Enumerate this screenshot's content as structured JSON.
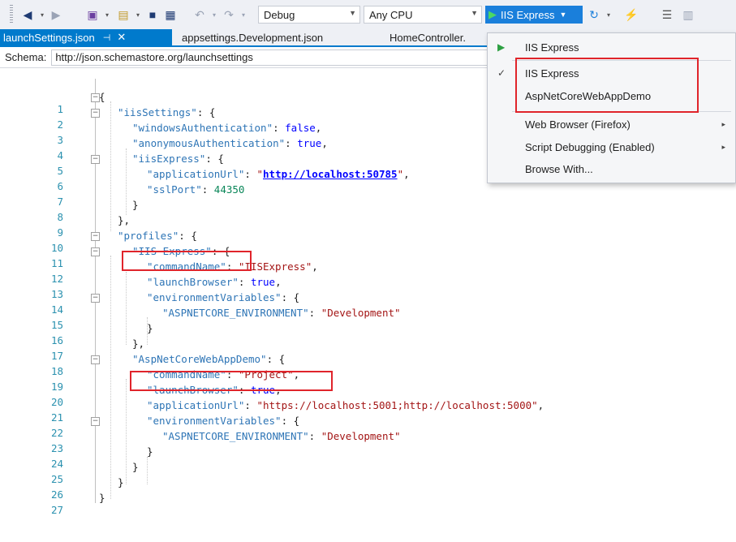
{
  "toolbar": {
    "config_label": "Debug",
    "platform_label": "Any CPU",
    "run_label": "IIS Express"
  },
  "tabs": [
    {
      "label": "launchSettings.json"
    },
    {
      "label": "appsettings.Development.json"
    },
    {
      "label": "HomeController."
    }
  ],
  "schema": {
    "label": "Schema:",
    "value": "http://json.schemastore.org/launchsettings"
  },
  "menu": {
    "items": [
      {
        "label": "IIS Express",
        "lead": "▶"
      },
      {
        "label": "IIS Express",
        "lead": "✓"
      },
      {
        "label": "AspNetCoreWebAppDemo",
        "lead": ""
      },
      {
        "label": "Web Browser (Firefox)",
        "lead": "",
        "sub": "▸"
      },
      {
        "label": "Script Debugging (Enabled)",
        "lead": "",
        "sub": "▸"
      },
      {
        "label": "Browse With...",
        "lead": ""
      }
    ]
  },
  "colors": {
    "accent": "#007acc",
    "run_button": "#1a7fdb",
    "annotation": "#e0242b",
    "json_key": "#2e75b6",
    "json_string": "#a31515"
  },
  "code": {
    "line_numbers": [
      "1",
      "2",
      "3",
      "4",
      "5",
      "6",
      "7",
      "8",
      "9",
      "10",
      "11",
      "12",
      "13",
      "14",
      "15",
      "16",
      "17",
      "18",
      "19",
      "20",
      "21",
      "22",
      "23",
      "24",
      "25",
      "26",
      "27"
    ],
    "l1": "{",
    "l2k": "\"iisSettings\"",
    "l2p": ": {",
    "l3k": "\"windowsAuthentication\"",
    "l3p": ": ",
    "l3v": "false",
    "l3e": ",",
    "l4k": "\"anonymousAuthentication\"",
    "l4p": ": ",
    "l4v": "true",
    "l4e": ",",
    "l5k": "\"iisExpress\"",
    "l5p": ": {",
    "l6k": "\"applicationUrl\"",
    "l6p": ": ",
    "l6q1": "\"",
    "l6v": "http://localhost:50785",
    "l6q2": "\"",
    "l6e": ",",
    "l7k": "\"sslPort\"",
    "l7p": ": ",
    "l7v": "44350",
    "l8": "}",
    "l9": "},",
    "l10k": "\"profiles\"",
    "l10p": ": {",
    "l11k": "\"IIS Express\"",
    "l11p": ": {",
    "l12k": "\"commandName\"",
    "l12p": ": ",
    "l12v": "\"IISExpress\"",
    "l12e": ",",
    "l13k": "\"launchBrowser\"",
    "l13p": ": ",
    "l13v": "true",
    "l13e": ",",
    "l14k": "\"environmentVariables\"",
    "l14p": ": {",
    "l15k": "\"ASPNETCORE_ENVIRONMENT\"",
    "l15p": ": ",
    "l15v": "\"Development\"",
    "l16": "}",
    "l17": "},",
    "l18k": "\"AspNetCoreWebAppDemo\"",
    "l18p": ": {",
    "l19k": "\"commandName\"",
    "l19p": ": ",
    "l19v": "\"Project\"",
    "l19e": ",",
    "l20k": "\"launchBrowser\"",
    "l20p": ": ",
    "l20v": "true",
    "l20e": ",",
    "l21k": "\"applicationUrl\"",
    "l21p": ": ",
    "l21v": "\"https://localhost:5001;http://localhost:5000\"",
    "l21e": ",",
    "l22k": "\"environmentVariables\"",
    "l22p": ": {",
    "l23k": "\"ASPNETCORE_ENVIRONMENT\"",
    "l23p": ": ",
    "l23v": "\"Development\"",
    "l24": "}",
    "l25": "}",
    "l26": "}",
    "l27": "}"
  }
}
